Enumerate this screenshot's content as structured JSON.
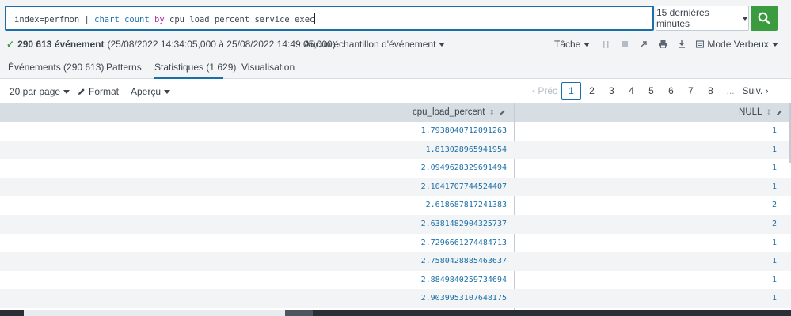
{
  "search": {
    "segments": [
      {
        "text": "index=perfmon | ",
        "kind": "plain"
      },
      {
        "text": "chart",
        "kind": "cmd"
      },
      {
        "text": " ",
        "kind": "plain"
      },
      {
        "text": "count",
        "kind": "cmd"
      },
      {
        "text": " ",
        "kind": "plain"
      },
      {
        "text": "by",
        "kind": "arg"
      },
      {
        "text": " cpu_load_percent service_exec",
        "kind": "plain"
      }
    ],
    "time_range": "15 dernières minutes",
    "submit_icon": "search-icon",
    "accent_color": "#1a6fa8",
    "submit_color": "#3b9c3f"
  },
  "status": {
    "check_icon": "✓",
    "events_count": "290 613 événement",
    "range": "(25/08/2022 14:34:05,000 à 25/08/2022 14:49:05,000)",
    "sampling": "Aucun échantillon d'événement",
    "job_label": "Tâche",
    "mode_label": "Mode Verbeux"
  },
  "tabs": [
    {
      "label": "Événements (290 613)",
      "active": false
    },
    {
      "label": "Patterns",
      "active": false
    },
    {
      "label": "Statistiques (1 629)",
      "active": true
    },
    {
      "label": "Visualisation",
      "active": false
    }
  ],
  "toolbar": {
    "per_page": "20 par page",
    "format": "Format",
    "preview": "Aperçu"
  },
  "pagination": {
    "prev": "‹ Préc",
    "pages": [
      "1",
      "2",
      "3",
      "4",
      "5",
      "6",
      "7",
      "8"
    ],
    "current": "1",
    "ellipsis": "...",
    "next": "Suiv. ›"
  },
  "table": {
    "columns": [
      "cpu_load_percent",
      "NULL"
    ],
    "rows": [
      [
        "1.7938040712091263",
        "1"
      ],
      [
        "1.813028965941954",
        "1"
      ],
      [
        "2.0949628329691494",
        "1"
      ],
      [
        "2.1041707744524407",
        "1"
      ],
      [
        "2.618687817241383",
        "2"
      ],
      [
        "2.6381482904325737",
        "2"
      ],
      [
        "2.7296661274484713",
        "1"
      ],
      [
        "2.7580428885463637",
        "1"
      ],
      [
        "2.8849840259734694",
        "1"
      ],
      [
        "2.9039953107648175",
        "1"
      ]
    ]
  }
}
